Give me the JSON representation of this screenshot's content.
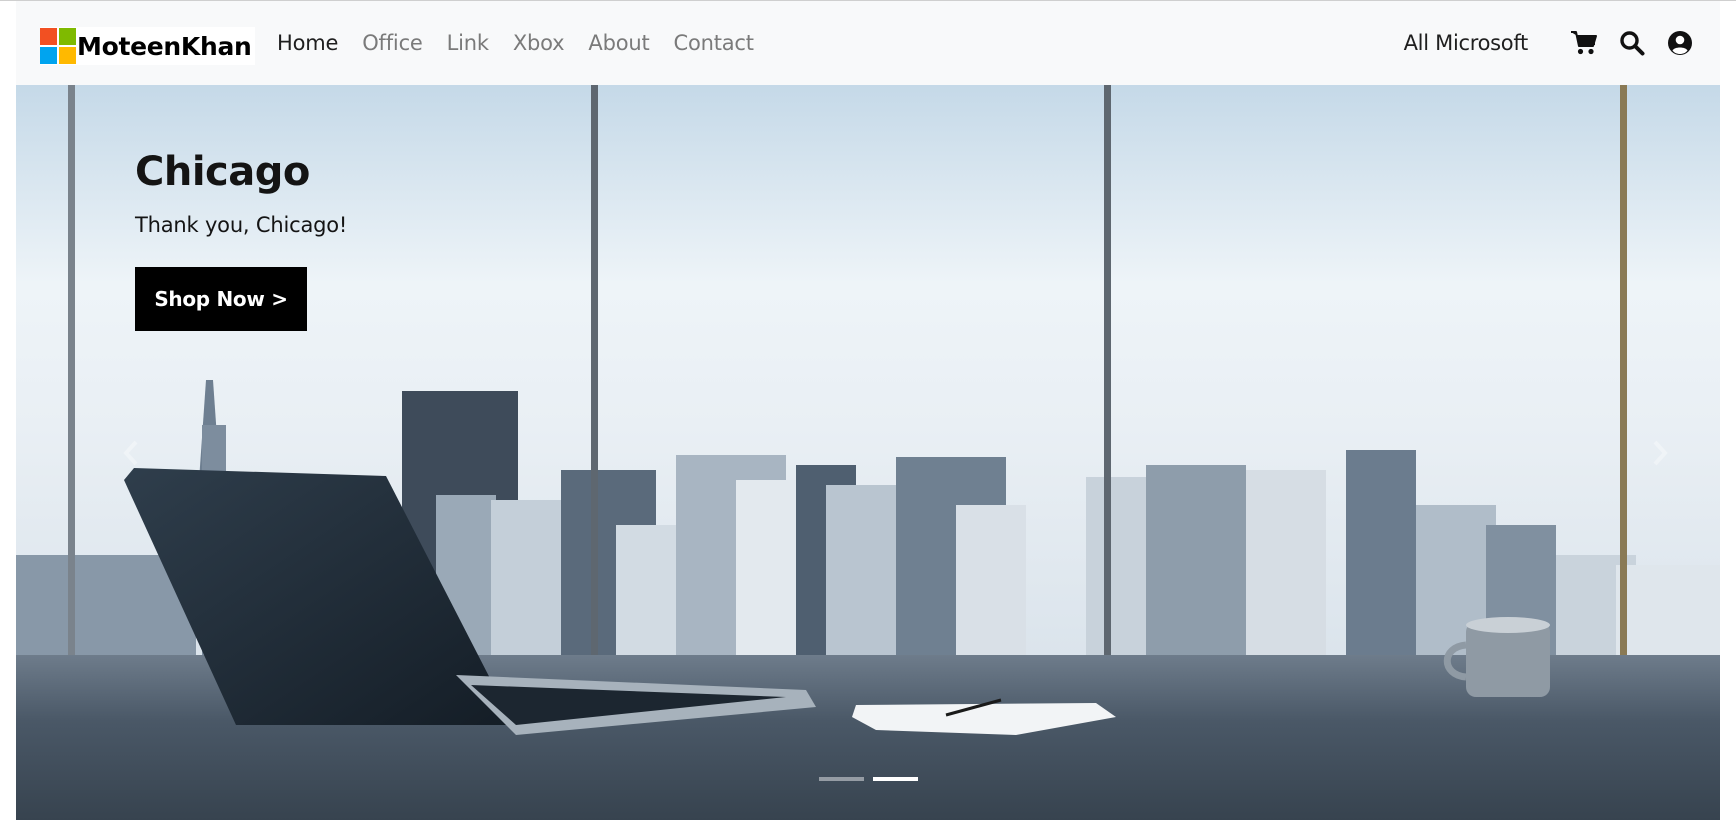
{
  "brand": {
    "name": "MoteenKhan"
  },
  "nav": {
    "links": [
      {
        "label": "Home",
        "active": true
      },
      {
        "label": "Office",
        "active": false
      },
      {
        "label": "Link",
        "active": false
      },
      {
        "label": "Xbox",
        "active": false
      },
      {
        "label": "About",
        "active": false
      },
      {
        "label": "Contact",
        "active": false
      }
    ],
    "all_microsoft": "All Microsoft",
    "icons": [
      "cart-icon",
      "search-icon",
      "user-icon"
    ]
  },
  "hero": {
    "title": "Chicago",
    "text": "Thank you, Chicago!",
    "button_label": "Shop Now >",
    "slides_count": 2,
    "active_slide": 2
  },
  "colors": {
    "nav_bg": "#f8f9fa",
    "nav_active": "#1f1f1f",
    "nav_inactive": "#7a7a7a",
    "button_bg": "#000000",
    "logo_red": "#f25022",
    "logo_green": "#7fba00",
    "logo_blue": "#00a4ef",
    "logo_yellow": "#ffb900"
  }
}
